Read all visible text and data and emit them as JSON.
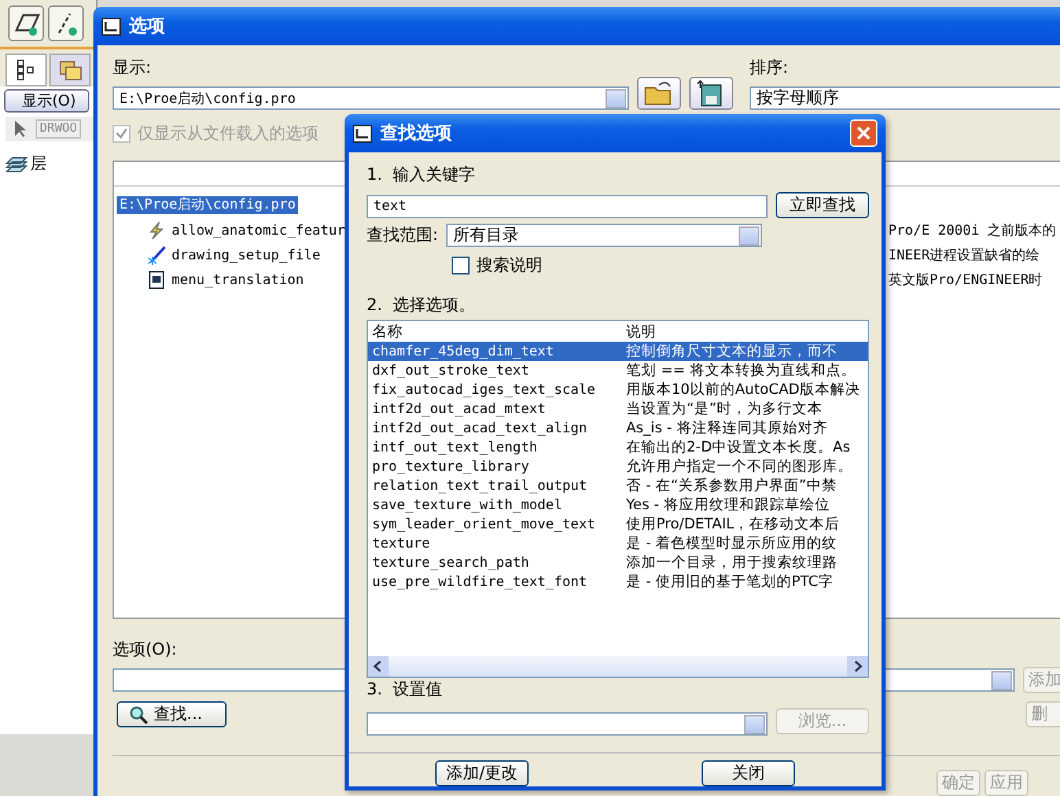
{
  "app": {
    "display_menu": "显示(O)",
    "toolbar_text": "DRWOO",
    "layer_item": "层"
  },
  "options_window": {
    "title": "选项",
    "display_label": "显示:",
    "display_value": "E:\\Proe启动\\config.pro",
    "sort_label": "排序:",
    "sort_value": "按字母顺序",
    "loaded_only": {
      "label": "仅显示从文件载入的选项",
      "checked": true,
      "disabled": true
    },
    "tree": {
      "label": "E:\\Proe启动\\config.pro",
      "selected": true,
      "children": [
        {
          "kind": "lightning",
          "label": "allow_anatomic_featur",
          "description": "Pro/E 2000i 之前版本的"
        },
        {
          "kind": "drawing",
          "label": "drawing_setup_file",
          "description": "INEER进程设置缺省的绘"
        },
        {
          "kind": "book",
          "label": "menu_translation",
          "description": "英文版Pro/ENGINEER时"
        }
      ]
    },
    "option_label": "选项(O):",
    "add_button": {
      "label": "添加",
      "disabled": true
    },
    "delete_button": {
      "label": "删",
      "disabled": true
    },
    "find_button": "查找...",
    "ok_button": {
      "label": "确定",
      "disabled": true
    },
    "apply_button": {
      "label": "应用",
      "disabled": true
    }
  },
  "find_dialog": {
    "title": "查找选项",
    "step1": "1.  输入关键字",
    "keyword": "text",
    "find_now_button": "立即查找",
    "scope_label": "查找范围:",
    "scope_value": "所有目录",
    "search_desc": {
      "label": "搜索说明",
      "checked": false
    },
    "step2": "2.  选择选项。",
    "columns": [
      "名称",
      "说明"
    ],
    "rows": [
      {
        "name": "chamfer_45deg_dim_text",
        "description": "控制倒角尺寸文本的显示，而不",
        "selected": true
      },
      {
        "name": "dxf_out_stroke_text",
        "description": "笔划 == 将文本转换为直线和点。",
        "selected": false
      },
      {
        "name": "fix_autocad_iges_text_scale",
        "description": "用版本10以前的AutoCAD版本解决",
        "selected": false
      },
      {
        "name": "intf2d_out_acad_mtext",
        "description": "当设置为“是”时，为多行文本",
        "selected": false
      },
      {
        "name": "intf2d_out_acad_text_align",
        "description": "As_is - 将注释连同其原始对齐",
        "selected": false
      },
      {
        "name": "intf_out_text_length",
        "description": "在输出的2-D中设置文本长度。As",
        "selected": false
      },
      {
        "name": "pro_texture_library",
        "description": "允许用户指定一个不同的图形库。",
        "selected": false
      },
      {
        "name": "relation_text_trail_output",
        "description": "否 - 在“关系参数用户界面”中禁",
        "selected": false
      },
      {
        "name": "save_texture_with_model",
        "description": "Yes - 将应用纹理和跟踪草绘位",
        "selected": false
      },
      {
        "name": "sym_leader_orient_move_text",
        "description": "使用Pro/DETAIL，在移动文本后",
        "selected": false
      },
      {
        "name": "texture",
        "description": "是 - 着色模型时显示所应用的纹",
        "selected": false
      },
      {
        "name": "texture_search_path",
        "description": "添加一个目录，用于搜索纹理路",
        "selected": false
      },
      {
        "name": "use_pre_wildfire_text_font",
        "description": "是 - 使用旧的基于笔划的PTC字",
        "selected": false
      }
    ],
    "step3": "3.  设置值",
    "browse_button": {
      "label": "浏览...",
      "disabled": true
    },
    "add_change_button": "添加/更改",
    "close_button": "关闭"
  }
}
